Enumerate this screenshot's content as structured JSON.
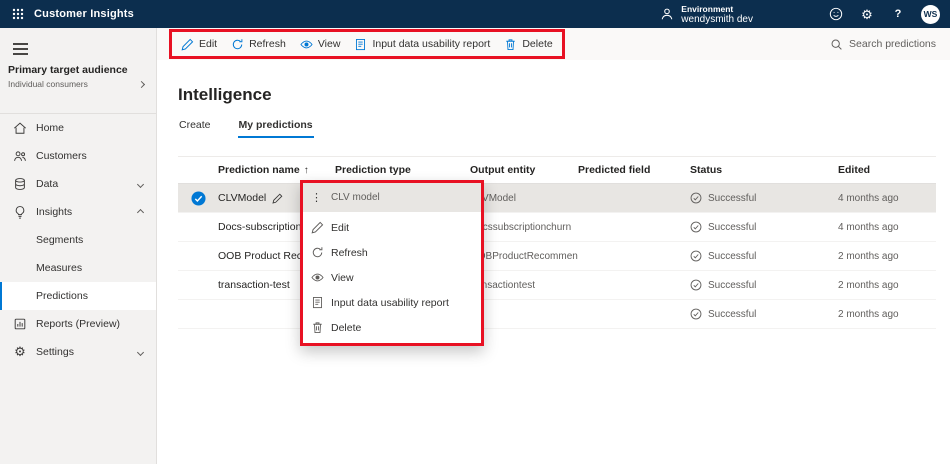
{
  "icons": {
    "more_options_glyph": "⋮",
    "sort_ascending_glyph": "↑",
    "settings_gear_glyph": "⚙"
  },
  "colors": {
    "topbar_bg": "#0c2e4e",
    "accent": "#0078d4",
    "highlight_red": "#e81123",
    "success_gray": "#605e5c"
  },
  "topbar": {
    "app_title": "Customer Insights",
    "environment_label": "Environment",
    "environment_name": "wendysmith dev",
    "help_label": "?",
    "avatar_initials": "WS"
  },
  "command_bar": {
    "buttons": [
      {
        "label": "Edit",
        "icon": "edit-icon"
      },
      {
        "label": "Refresh",
        "icon": "refresh-icon"
      },
      {
        "label": "View",
        "icon": "view-icon"
      },
      {
        "label": "Input data usability report",
        "icon": "report-icon"
      },
      {
        "label": "Delete",
        "icon": "delete-icon"
      }
    ],
    "search_placeholder": "Search predictions"
  },
  "sidebar": {
    "audience_title": "Primary target audience",
    "audience_subtitle": "Individual consumers",
    "items": [
      {
        "label": "Home",
        "icon": "home-icon"
      },
      {
        "label": "Customers",
        "icon": "customers-icon"
      },
      {
        "label": "Data",
        "icon": "data-icon",
        "chevron": "down"
      },
      {
        "label": "Insights",
        "icon": "insights-icon",
        "chevron": "up"
      },
      {
        "label": "Segments",
        "indent": true
      },
      {
        "label": "Measures",
        "indent": true
      },
      {
        "label": "Predictions",
        "indent": true,
        "selected": true
      },
      {
        "label": "Reports (Preview)",
        "icon": "reports-icon"
      },
      {
        "label": "Settings",
        "icon": "settings-icon",
        "chevron": "down"
      }
    ]
  },
  "main": {
    "title": "Intelligence",
    "tabs": [
      {
        "label": "Create",
        "active": false
      },
      {
        "label": "My predictions",
        "active": true
      }
    ],
    "table": {
      "headers": [
        "Prediction name",
        "Prediction type",
        "Output entity",
        "Predicted field",
        "Status",
        "Edited"
      ],
      "rows": [
        {
          "name": "CLVModel",
          "type": "CLV model",
          "output_entity": "CLVModel",
          "predicted_field": "",
          "status": "Successful",
          "edited": "4 months ago",
          "selected": true
        },
        {
          "name": "Docs-subscription",
          "type": "",
          "output_entity": "Docssubscriptionchurn",
          "predicted_field": "",
          "status": "Successful",
          "edited": "4 months ago",
          "selected": false
        },
        {
          "name": "OOB Product Reco",
          "type": "",
          "output_entity": "OOBProductRecommendation",
          "predicted_field": "",
          "status": "Successful",
          "edited": "2 months ago",
          "selected": false
        },
        {
          "name": "transaction-test",
          "type": "",
          "output_entity": "transactiontest",
          "predicted_field": "",
          "status": "Successful",
          "edited": "2 months ago",
          "selected": false
        },
        {
          "name": "",
          "type": "",
          "output_entity": "",
          "predicted_field": "",
          "status": "Successful",
          "edited": "2 months ago",
          "selected": false
        }
      ]
    }
  },
  "context_menu": {
    "selected_type_label": "CLV model",
    "items": [
      {
        "label": "Edit",
        "icon": "edit-icon"
      },
      {
        "label": "Refresh",
        "icon": "refresh-icon"
      },
      {
        "label": "View",
        "icon": "view-icon"
      },
      {
        "label": "Input data usability report",
        "icon": "report-icon"
      },
      {
        "label": "Delete",
        "icon": "delete-icon"
      }
    ]
  }
}
